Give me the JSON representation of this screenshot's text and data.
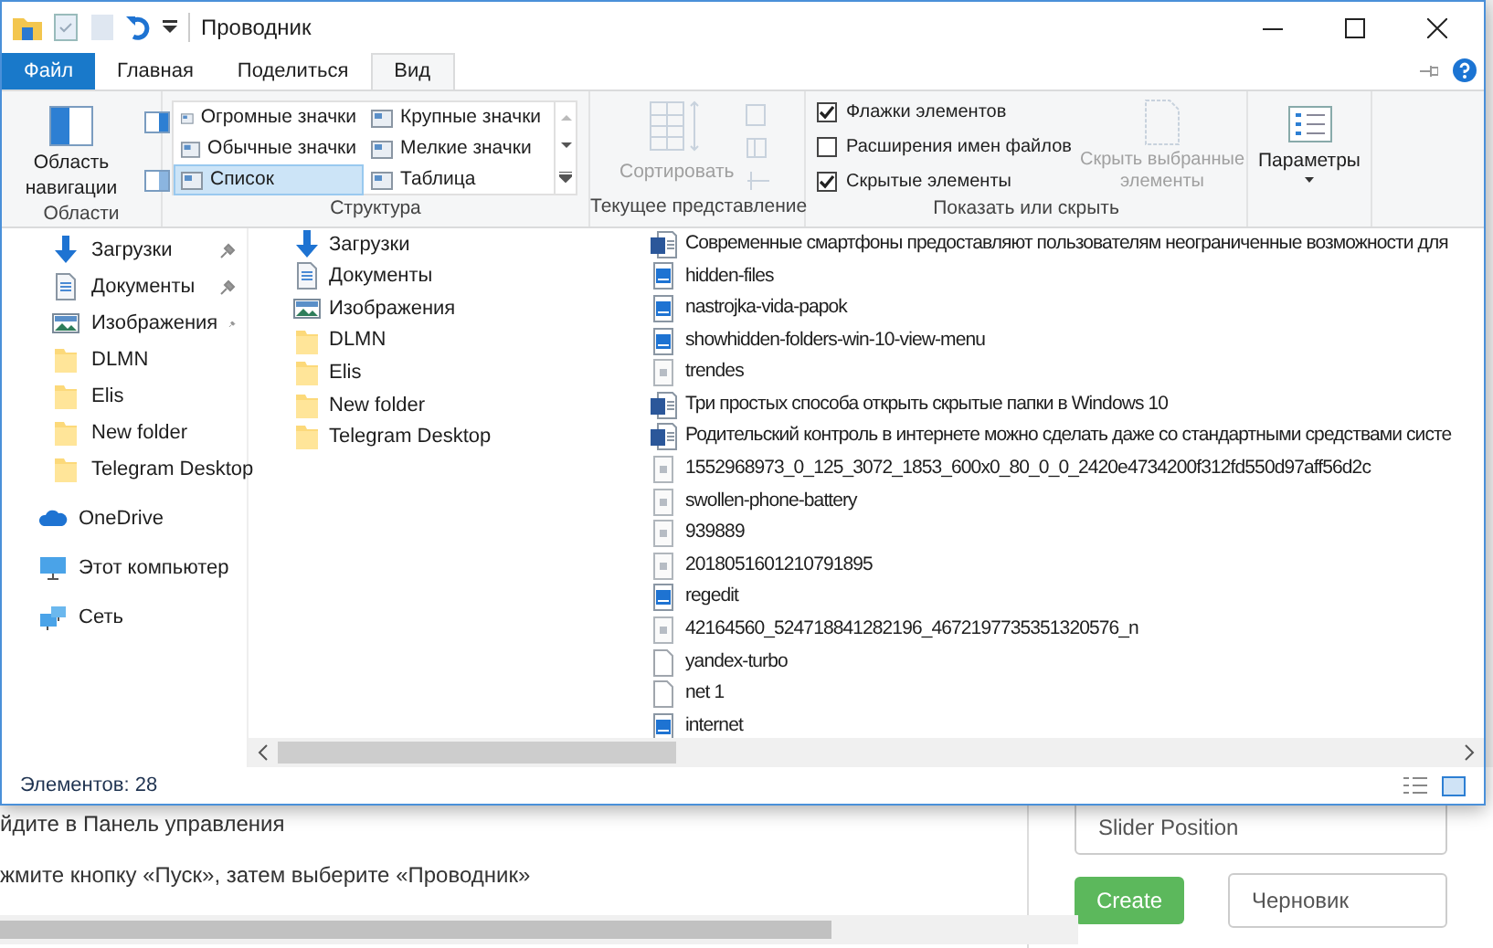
{
  "window": {
    "title": "Проводник"
  },
  "ribbon_tabs": [
    {
      "label": "Файл",
      "kind": "file",
      "selected": false
    },
    {
      "label": "Главная",
      "kind": "tab",
      "selected": false
    },
    {
      "label": "Поделиться",
      "kind": "tab",
      "selected": false
    },
    {
      "label": "Вид",
      "kind": "tab",
      "selected": true
    }
  ],
  "ribbon": {
    "panes": {
      "nav_label": "Область навигации",
      "group": "Области"
    },
    "layout": {
      "options": [
        {
          "label": "Огромные значки",
          "selected": false
        },
        {
          "label": "Крупные значки",
          "selected": false
        },
        {
          "label": "Обычные значки",
          "selected": false
        },
        {
          "label": "Мелкие значки",
          "selected": false
        },
        {
          "label": "Список",
          "selected": true
        },
        {
          "label": "Таблица",
          "selected": false
        }
      ],
      "group": "Структура"
    },
    "current_view": {
      "sort_label": "Сортировать",
      "group": "Текущее представление"
    },
    "show_hide": {
      "checkboxes": [
        {
          "label": "Флажки элементов",
          "checked": true
        },
        {
          "label": "Расширения имен файлов",
          "checked": false
        },
        {
          "label": "Скрытые элементы",
          "checked": true
        }
      ],
      "hide_selected": "Скрыть выбранные элементы",
      "group": "Показать или скрыть"
    },
    "options": {
      "label": "Параметры"
    }
  },
  "nav_pane": [
    {
      "label": "Загрузки",
      "kind": "download",
      "pinned": true
    },
    {
      "label": "Документы",
      "kind": "doc",
      "pinned": true
    },
    {
      "label": "Изображения",
      "kind": "image",
      "pinned": true
    },
    {
      "label": "DLMN",
      "kind": "folder",
      "pinned": false
    },
    {
      "label": "Elis",
      "kind": "folder",
      "pinned": false
    },
    {
      "label": "New folder",
      "kind": "folder",
      "pinned": false
    },
    {
      "label": "Telegram Desktop",
      "kind": "folder",
      "pinned": false
    },
    {
      "label": "OneDrive",
      "kind": "cloud",
      "pinned": false
    },
    {
      "label": "Этот компьютер",
      "kind": "pc",
      "pinned": false
    },
    {
      "label": "Сеть",
      "kind": "network",
      "pinned": false
    }
  ],
  "files_column_1": [
    {
      "name": "Загрузки",
      "kind": "download"
    },
    {
      "name": "Документы",
      "kind": "doc"
    },
    {
      "name": "Изображения",
      "kind": "image"
    },
    {
      "name": "DLMN",
      "kind": "folder"
    },
    {
      "name": "Elis",
      "kind": "folder"
    },
    {
      "name": "New folder",
      "kind": "folder"
    },
    {
      "name": "Telegram Desktop",
      "kind": "folder"
    }
  ],
  "files_column_2": [
    {
      "name": "Современные смартфоны предоставляют пользователям неограниченные возможности для",
      "kind": "word"
    },
    {
      "name": "hidden-files",
      "kind": "picture"
    },
    {
      "name": "nastrojka-vida-papok",
      "kind": "picture"
    },
    {
      "name": "showhidden-folders-win-10-view-menu",
      "kind": "picture"
    },
    {
      "name": "trendes",
      "kind": "image_file"
    },
    {
      "name": "Три простых способа открыть скрытые папки в Windows 10",
      "kind": "word"
    },
    {
      "name": "Родительский контроль в интернете можно сделать даже со стандартными средствами систе",
      "kind": "word"
    },
    {
      "name": "1552968973_0_125_3072_1853_600x0_80_0_0_2420e4734200f312fd550d97aff56d2c",
      "kind": "image_file"
    },
    {
      "name": "swollen-phone-battery",
      "kind": "image_file"
    },
    {
      "name": "939889",
      "kind": "image_file"
    },
    {
      "name": "2018051601210791895",
      "kind": "image_file"
    },
    {
      "name": "regedit",
      "kind": "picture"
    },
    {
      "name": "42164560_524718841282196_4672197735351320576_n",
      "kind": "image_file"
    },
    {
      "name": "yandex-turbo",
      "kind": "blank"
    },
    {
      "name": "net 1",
      "kind": "blank"
    },
    {
      "name": "internet",
      "kind": "picture"
    }
  ],
  "status_bar": {
    "count": "Элементов: 28"
  },
  "background_page": {
    "lines": [
      "йдите в Панель управления",
      "жмите кнопку «Пуск», затем выберите «Проводник»"
    ],
    "field_value": "Slider Position",
    "create_button": "Create",
    "status_select": "Черновик"
  }
}
